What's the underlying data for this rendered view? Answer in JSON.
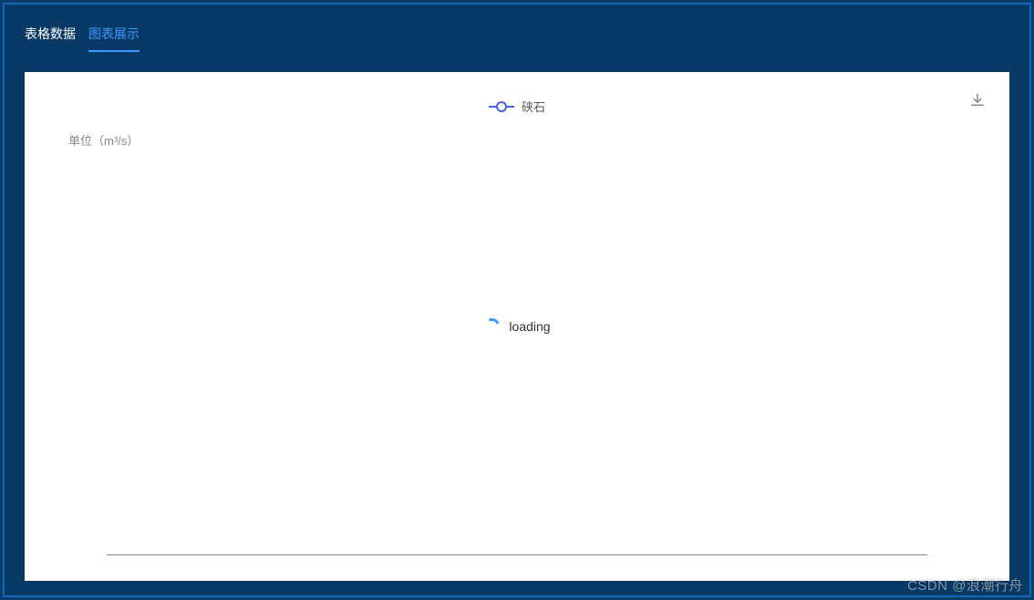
{
  "tabs": {
    "table_data": "表格数据",
    "chart_display": "图表展示"
  },
  "active_tab": "chart_display",
  "legend": {
    "series_name": "硖石"
  },
  "unit_label": "单位（m³/s）",
  "loading_text": "loading",
  "watermark": "CSDN @浪潮行舟",
  "chart_data": {
    "type": "line",
    "title": "",
    "xlabel": "",
    "ylabel": "单位（m³/s）",
    "series": [
      {
        "name": "硖石",
        "values": []
      }
    ],
    "categories": [],
    "state": "loading"
  },
  "colors": {
    "accent": "#3b9aff",
    "background_dark": "#083a68",
    "border_dark": "#1268b5",
    "legend_color": "#4b5eea"
  }
}
